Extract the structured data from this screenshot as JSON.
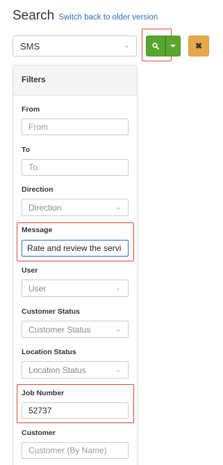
{
  "header": {
    "title": "Search",
    "switch_link": "Switch back to older version"
  },
  "toolbar": {
    "type_value": "SMS",
    "search_icon": "search-icon",
    "dropdown_icon": "caret-down-icon",
    "clear_label": "✖",
    "colors": {
      "search": "#5aa52e",
      "clear": "#e8a84a",
      "highlight": "#e0453a"
    }
  },
  "filters": {
    "heading": "Filters",
    "from": {
      "label": "From",
      "placeholder": "From"
    },
    "to": {
      "label": "To",
      "placeholder": "To"
    },
    "direction": {
      "label": "Direction",
      "value": "Direction"
    },
    "message": {
      "label": "Message",
      "value": "Rate and review the servi"
    },
    "user": {
      "label": "User",
      "value": "User"
    },
    "customer_status": {
      "label": "Customer Status",
      "value": "Customer Status"
    },
    "location_status": {
      "label": "Location Status",
      "value": "Location Status"
    },
    "job_number": {
      "label": "Job Number",
      "value": "52737"
    },
    "customer": {
      "label": "Customer",
      "placeholder": "Customer (By Name)"
    }
  }
}
